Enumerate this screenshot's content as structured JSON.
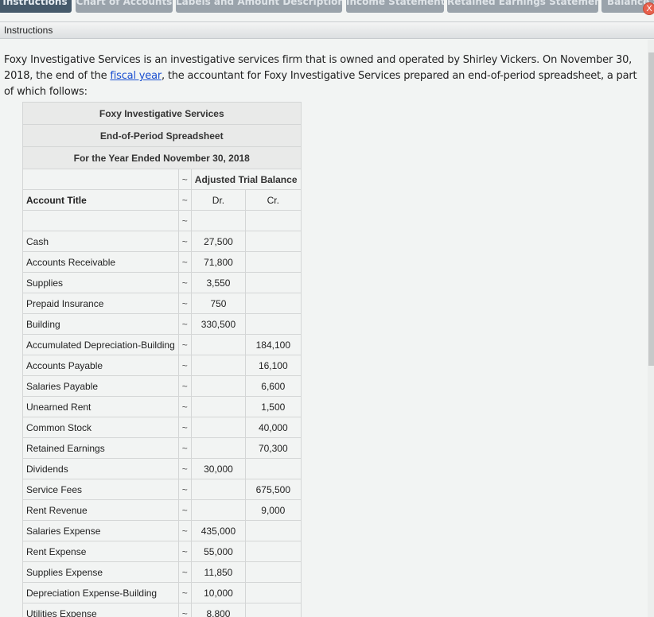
{
  "tabs": [
    {
      "label": "Instructions",
      "active": true
    },
    {
      "label": "Chart of Accounts",
      "active": false
    },
    {
      "label": "Labels and Amount Descriptions",
      "active": false
    },
    {
      "label": "Income Statement",
      "active": false
    },
    {
      "label": "Retained Earnings Statement",
      "active": false
    },
    {
      "label": "Balance Sheet",
      "active": false
    }
  ],
  "panel": {
    "title": "Instructions",
    "close_label": "X"
  },
  "intro": {
    "part1": "Foxy Investigative Services is an investigative services firm that is owned and operated by Shirley Vickers. On November 30, 2018, the end of the ",
    "link": "fiscal year",
    "part2": ", the accountant for Foxy Investigative Services prepared an end-of-period spreadsheet, a part of which follows:"
  },
  "spreadsheet": {
    "company": "Foxy Investigative Services",
    "title": "End-of-Period Spreadsheet",
    "period": "For the Year Ended November 30, 2018",
    "group_header": "Adjusted Trial Balance",
    "col_account": "Account Title",
    "col_dr": "Dr.",
    "col_cr": "Cr.",
    "tilde": "~",
    "rows": [
      {
        "account": "Cash",
        "dr": "27,500",
        "cr": ""
      },
      {
        "account": "Accounts Receivable",
        "dr": "71,800",
        "cr": ""
      },
      {
        "account": "Supplies",
        "dr": "3,550",
        "cr": ""
      },
      {
        "account": "Prepaid Insurance",
        "dr": "750",
        "cr": ""
      },
      {
        "account": "Building",
        "dr": "330,500",
        "cr": ""
      },
      {
        "account": "Accumulated Depreciation-Building",
        "dr": "",
        "cr": "184,100"
      },
      {
        "account": "Accounts Payable",
        "dr": "",
        "cr": "16,100"
      },
      {
        "account": "Salaries Payable",
        "dr": "",
        "cr": "6,600"
      },
      {
        "account": "Unearned Rent",
        "dr": "",
        "cr": "1,500"
      },
      {
        "account": "Common Stock",
        "dr": "",
        "cr": "40,000"
      },
      {
        "account": "Retained Earnings",
        "dr": "",
        "cr": "70,300"
      },
      {
        "account": "Dividends",
        "dr": "30,000",
        "cr": ""
      },
      {
        "account": "Service Fees",
        "dr": "",
        "cr": "675,500"
      },
      {
        "account": "Rent Revenue",
        "dr": "",
        "cr": "9,000"
      },
      {
        "account": "Salaries Expense",
        "dr": "435,000",
        "cr": ""
      },
      {
        "account": "Rent Expense",
        "dr": "55,000",
        "cr": ""
      },
      {
        "account": "Supplies Expense",
        "dr": "11,850",
        "cr": ""
      },
      {
        "account": "Depreciation Expense-Building",
        "dr": "10,000",
        "cr": ""
      },
      {
        "account": "Utilities Expense",
        "dr": "8,800",
        "cr": ""
      }
    ]
  }
}
